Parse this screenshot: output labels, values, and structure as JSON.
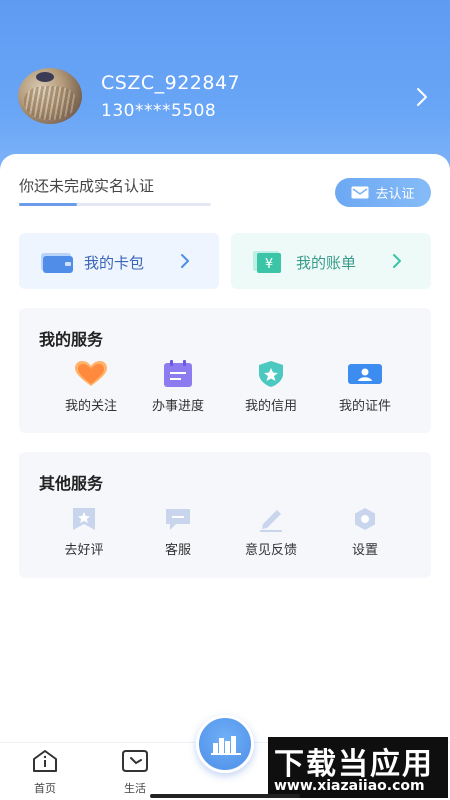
{
  "profile": {
    "username": "CSZC_922847",
    "phone": "130****5508"
  },
  "verify": {
    "prompt": "你还未完成实名认证",
    "button_label": "去认证",
    "progress": 0.3
  },
  "quick_links": [
    {
      "label": "我的卡包",
      "icon": "wallet-icon"
    },
    {
      "label": "我的账单",
      "icon": "bill-icon"
    }
  ],
  "my_services": {
    "title": "我的服务",
    "items": [
      {
        "label": "我的关注",
        "icon": "heart-icon"
      },
      {
        "label": "办事进度",
        "icon": "progress-doc-icon"
      },
      {
        "label": "我的信用",
        "icon": "shield-star-icon"
      },
      {
        "label": "我的证件",
        "icon": "id-card-icon"
      }
    ]
  },
  "other_services": {
    "title": "其他服务",
    "items": [
      {
        "label": "去好评",
        "icon": "bookmark-star-icon"
      },
      {
        "label": "客服",
        "icon": "chat-icon"
      },
      {
        "label": "意见反馈",
        "icon": "pencil-icon"
      },
      {
        "label": "设置",
        "icon": "gear-icon"
      }
    ]
  },
  "tabbar": {
    "tabs": [
      {
        "label": "首页",
        "icon": "home-icon"
      },
      {
        "label": "生活",
        "icon": "life-icon"
      }
    ],
    "center_icon": "city-skyline-icon"
  },
  "watermark": {
    "text": "下载当应用",
    "url": "www.xiazaiiao.com"
  },
  "colors": {
    "header": "#6aa6f6",
    "accent": "#5f9bf2",
    "wallet_bg": "#eef5fe",
    "bill_bg": "#eefaf8",
    "section_bg": "#f6f7fb"
  }
}
